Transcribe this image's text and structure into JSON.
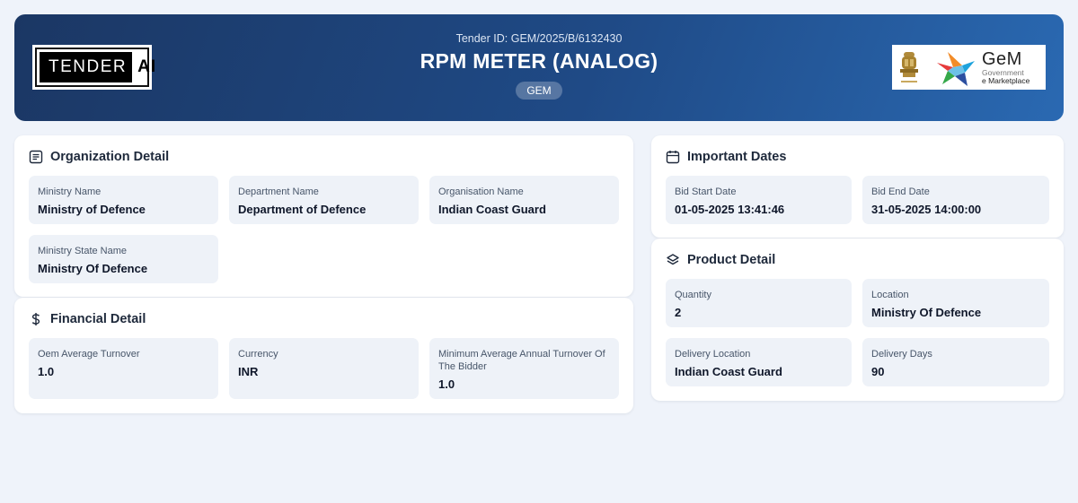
{
  "header": {
    "logo_left": {
      "brand": "TENDER",
      "suffix": "AI"
    },
    "tender_id_label": "Tender ID:",
    "tender_id": "GEM/2025/B/6132430",
    "title": "RPM METER (ANALOG)",
    "badge": "GEM",
    "logo_right": {
      "brand": "GeM",
      "line1": "Government",
      "line2": "e Marketplace",
      "emblem_icon": "national-emblem-icon",
      "star_icon": "gem-star-icon"
    }
  },
  "organization": {
    "title": "Organization Detail",
    "icon": "list-icon",
    "fields": [
      {
        "label": "Ministry Name",
        "value": "Ministry of Defence"
      },
      {
        "label": "Department Name",
        "value": "Department of Defence"
      },
      {
        "label": "Organisation Name",
        "value": "Indian Coast Guard"
      },
      {
        "label": "Ministry State Name",
        "value": "Ministry Of Defence"
      }
    ]
  },
  "financial": {
    "title": "Financial Detail",
    "icon": "dollar-icon",
    "fields": [
      {
        "label": "Oem Average Turnover",
        "value": "1.0"
      },
      {
        "label": "Currency",
        "value": "INR"
      },
      {
        "label": "Minimum Average Annual Turnover Of The Bidder",
        "value": "1.0"
      }
    ]
  },
  "dates": {
    "title": "Important Dates",
    "icon": "calendar-icon",
    "fields": [
      {
        "label": "Bid Start Date",
        "value": "01-05-2025 13:41:46"
      },
      {
        "label": "Bid End Date",
        "value": "31-05-2025 14:00:00"
      }
    ]
  },
  "product": {
    "title": "Product Detail",
    "icon": "layers-icon",
    "fields": [
      {
        "label": "Quantity",
        "value": "2"
      },
      {
        "label": "Location",
        "value": "Ministry Of Defence"
      },
      {
        "label": "Delivery Location",
        "value": "Indian Coast Guard"
      },
      {
        "label": "Delivery Days",
        "value": "90"
      }
    ]
  },
  "colors": {
    "header_start": "#1b3764",
    "header_end": "#2a69b2",
    "page_bg": "#eff3fa",
    "field_bg": "#eef2f8"
  }
}
